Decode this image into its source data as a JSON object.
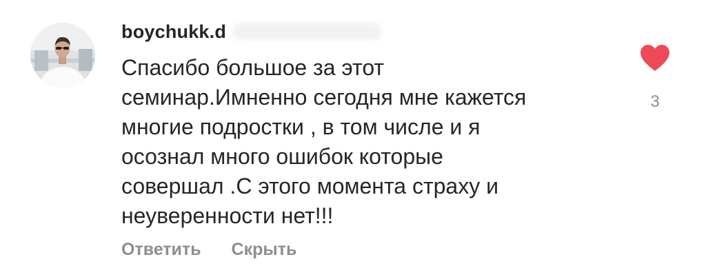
{
  "comment": {
    "username": "boychukk.d",
    "text_lines": [
      "Спасибо большое за этот",
      "семинар.Имненно сегодня мне кажется",
      "многие подростки , в том числе и я",
      "осознал много ошибок которые",
      "совершал .С этого момента страху и",
      "неуверенности нет!!!"
    ],
    "actions": {
      "reply_label": "Ответить",
      "hide_label": "Скрыть"
    },
    "like": {
      "icon": "heart-icon",
      "count": "3",
      "liked": true,
      "color": "#ed4956"
    },
    "avatar": {
      "icon": "profile-photo"
    }
  }
}
